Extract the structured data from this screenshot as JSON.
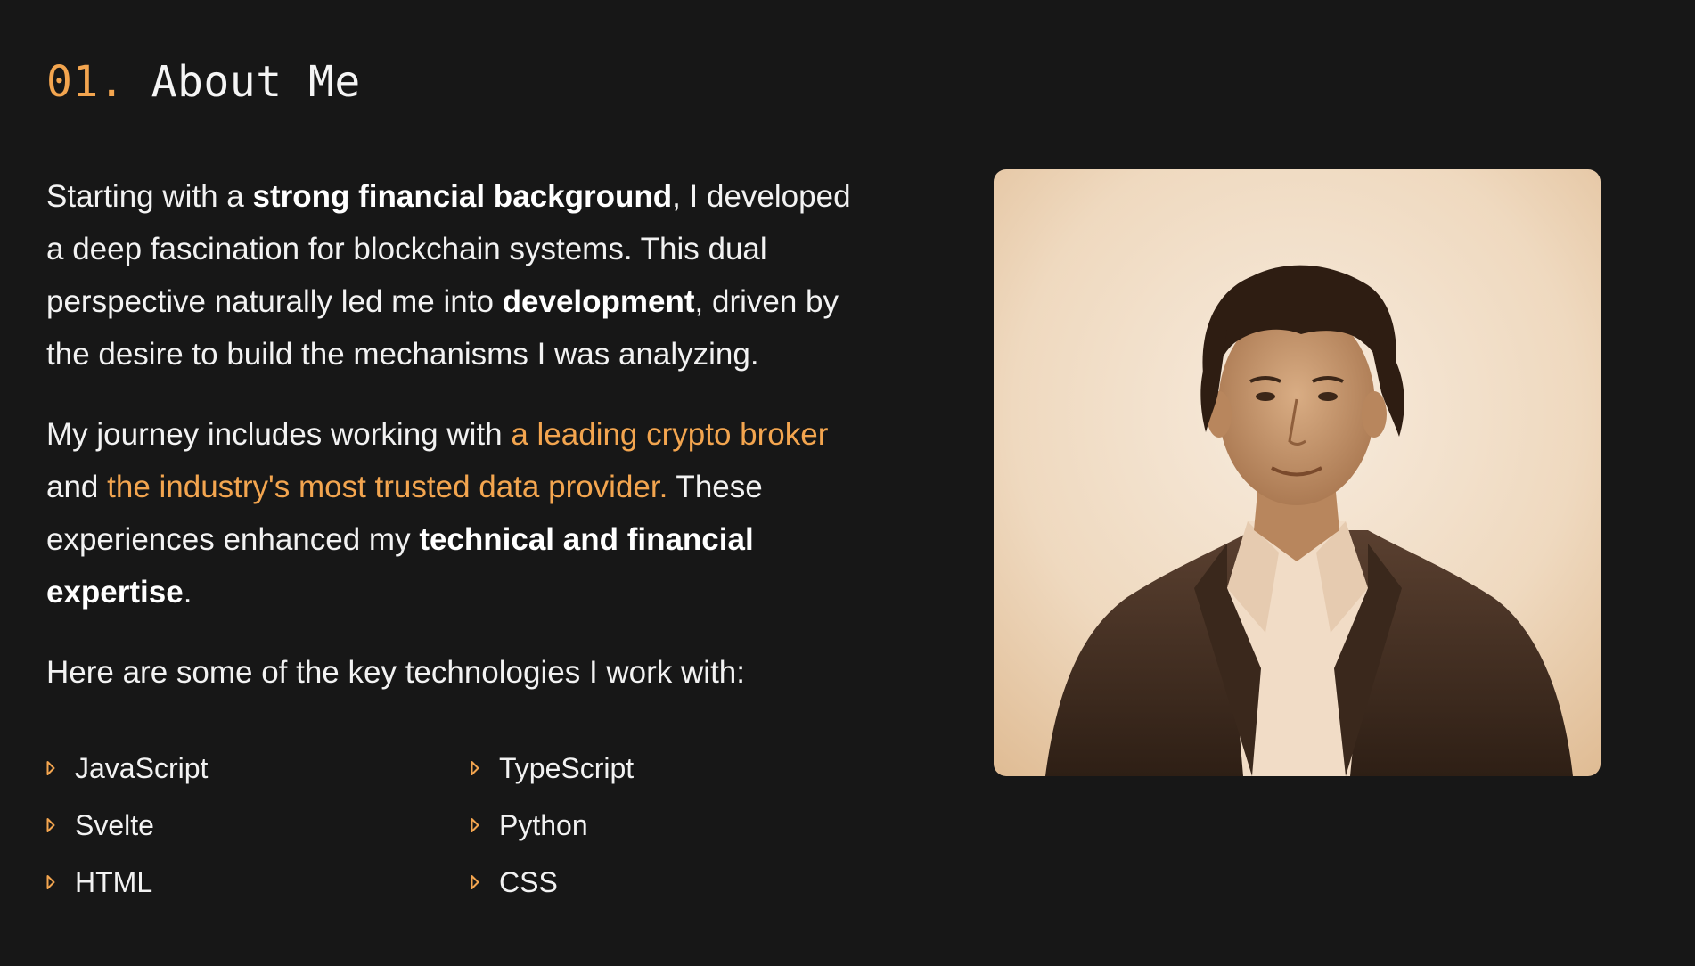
{
  "section": {
    "number": "01.",
    "title": "About Me"
  },
  "about": {
    "p1": {
      "t1": "Starting with a ",
      "b1": "strong financial background",
      "t2": ", I developed a deep fascination for blockchain systems. This dual perspective naturally led me into ",
      "b2": "development",
      "t3": ", driven by the desire to build the mechanisms I was analyzing."
    },
    "p2": {
      "t1": "My journey includes working with ",
      "link1": "a leading crypto broker",
      "t2": " and ",
      "link2": "the industry's most trusted data provider.",
      "t3": " These experiences enhanced my ",
      "b1": "technical and financial expertise",
      "t4": "."
    },
    "p3": "Here are some of the key technologies I work with:"
  },
  "technologies": [
    "JavaScript",
    "TypeScript",
    "Svelte",
    "Python",
    "HTML",
    "CSS"
  ],
  "colors": {
    "background": "#171717",
    "accent": "#f3a54f",
    "text": "#f2f2f2"
  },
  "icons": {
    "bullet": "triangle-right-outline-icon"
  }
}
